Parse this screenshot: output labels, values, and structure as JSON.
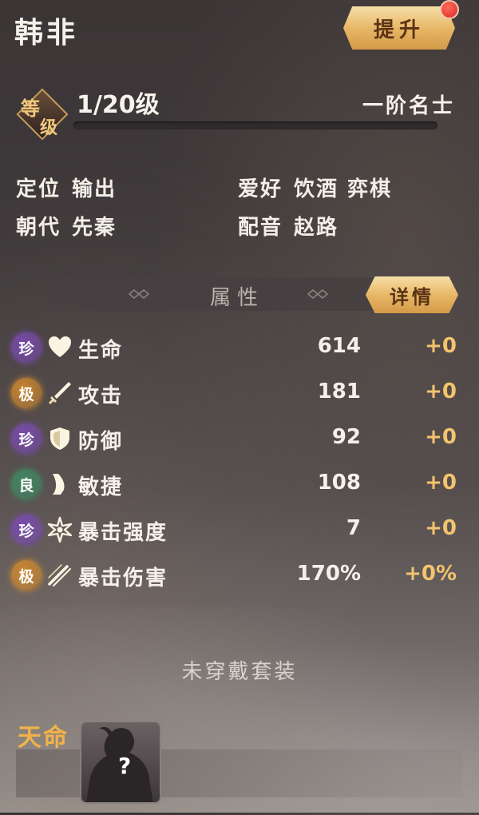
{
  "header": {
    "character_name": "韩非",
    "upgrade_label": "提升"
  },
  "level": {
    "badge_char_1": "等",
    "badge_char_2": "级",
    "text": "1/20级",
    "progress": 0.0,
    "rank": "一阶名士"
  },
  "info": {
    "role_key": "定位",
    "role_value": "输出",
    "hobby_key": "爱好",
    "hobby_value": "饮酒 弈棋",
    "dynasty_key": "朝代",
    "dynasty_value": "先秦",
    "voice_key": "配音",
    "voice_value": "赵路"
  },
  "attributes": {
    "title": "属性",
    "detail_label": "详情",
    "stats": [
      {
        "grade": "珍",
        "grade_color": "#7a4bb0",
        "icon": "heart-icon",
        "label": "生命",
        "value": "614",
        "bonus": "+0"
      },
      {
        "grade": "极",
        "grade_color": "#d18a2e",
        "icon": "sword-icon",
        "label": "攻击",
        "value": "181",
        "bonus": "+0"
      },
      {
        "grade": "珍",
        "grade_color": "#7a4bb0",
        "icon": "shield-icon",
        "label": "防御",
        "value": "92",
        "bonus": "+0"
      },
      {
        "grade": "良",
        "grade_color": "#3f8a63",
        "icon": "boot-icon",
        "label": "敏捷",
        "value": "108",
        "bonus": "+0"
      },
      {
        "grade": "珍",
        "grade_color": "#7a4bb0",
        "icon": "burst-icon",
        "label": "暴击强度",
        "value": "7",
        "bonus": "+0"
      },
      {
        "grade": "极",
        "grade_color": "#d18a2e",
        "icon": "slash-icon",
        "label": "暴击伤害",
        "value": "170%",
        "bonus": "+0%"
      }
    ]
  },
  "suit": {
    "empty_text": "未穿戴套装"
  },
  "fate": {
    "label": "天命",
    "slot_mark": "?"
  },
  "colors": {
    "gold_button": "#e8b867",
    "bonus_text": "#f3c36d",
    "fate_label": "#f1b24a",
    "notification_dot": "#d92b22"
  }
}
